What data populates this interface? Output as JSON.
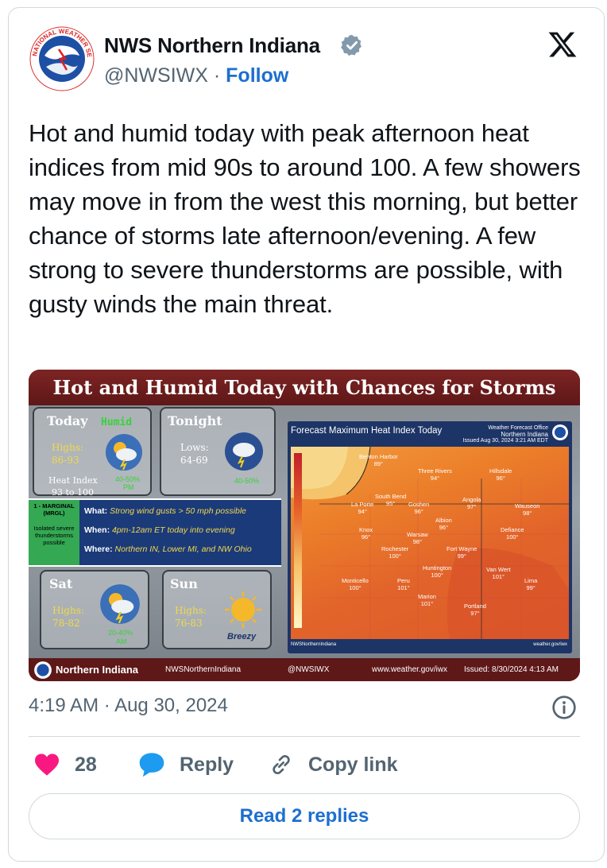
{
  "author": {
    "name": "NWS Northern Indiana",
    "handle": "@NWSIWX",
    "separator": "·",
    "follow_label": "Follow",
    "verified_color": "#829aab",
    "avatar_logo_text": "NATIONAL WEATHER SERVICE"
  },
  "tweet": {
    "text": "Hot and humid today with peak afternoon heat indices from mid 90s to around 100.  A few showers may move in from the west this morning, but better chance of storms late afternoon/evening.  A few strong to severe thunderstorms are possible, with gusty winds the main threat."
  },
  "graphic": {
    "title": "Hot and Humid Today with Chances for Storms",
    "today": {
      "label": "Today",
      "badge": "Humid",
      "highs_label": "Highs:",
      "highs": "86-93",
      "heat_label": "Heat Index",
      "heat": "93 to 100",
      "pop": "40-50%",
      "pop_time": "PM"
    },
    "tonight": {
      "label": "Tonight",
      "lows_label": "Lows:",
      "lows": "64-69",
      "pop": "40-50%"
    },
    "outlook": {
      "tag": "1 - MARGINAL (MRGL)",
      "tag_sub": "Isolated severe thunderstorms possible",
      "what_label": "What:",
      "what": "Strong wind gusts > 50 mph possible",
      "when_label": "When:",
      "when": "4pm-12am ET today into evening",
      "where_label": "Where:",
      "where": "Northern IN, Lower MI, and NW Ohio"
    },
    "sat": {
      "label": "Sat",
      "highs_label": "Highs:",
      "highs": "78-82",
      "pop": "20-40%",
      "pop_time": "AM"
    },
    "sun": {
      "label": "Sun",
      "highs_label": "Highs:",
      "highs": "76-83",
      "note": "Breezy"
    },
    "map": {
      "title": "Forecast Maximum Heat Index Today",
      "office_line1": "Weather Forecast Office",
      "office_line2": "Northern Indiana",
      "office_line3": "Issued Aug 30, 2024 3:21 AM EDT",
      "scale_label": "Max Apparent Temperature (F)",
      "scale_ticks": [
        "105°",
        "100°",
        "95°",
        "90°",
        "85°",
        "80°",
        "75°",
        "70°"
      ],
      "cities": [
        {
          "name": "Benton Harbor",
          "value": "89°"
        },
        {
          "name": "Three Rivers",
          "value": "94°"
        },
        {
          "name": "Hillsdale",
          "value": "96°"
        },
        {
          "name": "South Bend",
          "value": "95°"
        },
        {
          "name": "La Porte",
          "value": "94°"
        },
        {
          "name": "Goshen",
          "value": "96°"
        },
        {
          "name": "Angola",
          "value": "97°"
        },
        {
          "name": "Wauseon",
          "value": "98°"
        },
        {
          "name": "Albion",
          "value": "96°"
        },
        {
          "name": "Knox",
          "value": "96°"
        },
        {
          "name": "Warsaw",
          "value": "98°"
        },
        {
          "name": "Defiance",
          "value": "100°"
        },
        {
          "name": "Rochester",
          "value": "100°"
        },
        {
          "name": "Fort Wayne",
          "value": "99°"
        },
        {
          "name": "Huntington",
          "value": "100°"
        },
        {
          "name": "Van Wert",
          "value": "101°"
        },
        {
          "name": "Lima",
          "value": "99°"
        },
        {
          "name": "Monticello",
          "value": "100°"
        },
        {
          "name": "Peru",
          "value": "101°"
        },
        {
          "name": "Marion",
          "value": "101°"
        },
        {
          "name": "Portland",
          "value": "97°"
        }
      ],
      "interstates": [
        "94",
        "90",
        "69",
        "75",
        "65"
      ],
      "bottom_left": "NWSNorthernIndiana",
      "bottom_right": "weather.gov/iwx"
    },
    "footer": {
      "office": "Northern Indiana",
      "facebook": "NWSNorthernIndiana",
      "twitter": "@NWSIWX",
      "website": "www.weather.gov/iwx",
      "issued": "Issued:  8/30/2024 4:13 AM"
    }
  },
  "timestamp": {
    "time": "4:19 AM",
    "separator": "·",
    "date": "Aug 30, 2024"
  },
  "actions": {
    "likes": "28",
    "reply_label": "Reply",
    "copy_label": "Copy link",
    "like_color": "#f91880",
    "reply_color": "#1d9bf0"
  },
  "read_replies_label": "Read 2 replies"
}
